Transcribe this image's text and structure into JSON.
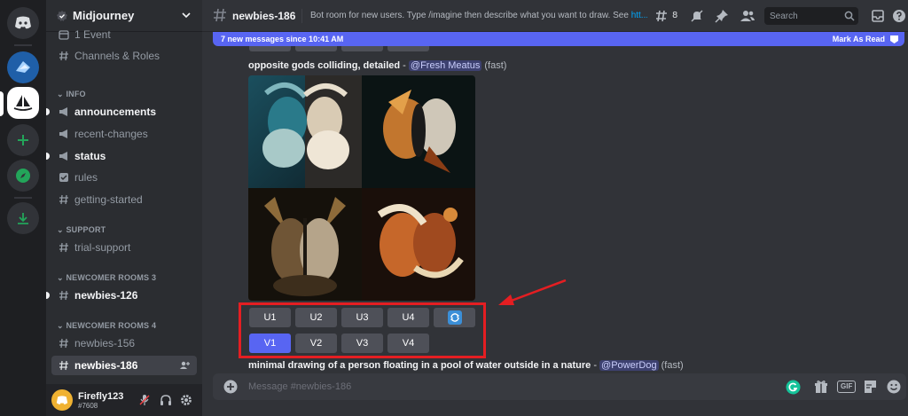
{
  "server": {
    "name": "Midjourney"
  },
  "sidebar": {
    "top_items": [
      {
        "label": "1 Event"
      },
      {
        "label": "Channels & Roles"
      }
    ],
    "categories": [
      {
        "label": "INFO"
      },
      {
        "label": "SUPPORT"
      },
      {
        "label": "NEWCOMER ROOMS 3"
      },
      {
        "label": "NEWCOMER ROOMS 4"
      }
    ],
    "channels": [
      {
        "label": "announcements",
        "icon": "megaphone-icon",
        "state": "unread"
      },
      {
        "label": "recent-changes",
        "icon": "megaphone-icon",
        "state": "normal"
      },
      {
        "label": "status",
        "icon": "megaphone-icon",
        "state": "unread"
      },
      {
        "label": "rules",
        "icon": "checkbox-icon",
        "state": "normal"
      },
      {
        "label": "getting-started",
        "icon": "hash-icon",
        "state": "normal"
      },
      {
        "label": "trial-support",
        "icon": "hash-icon",
        "state": "normal"
      },
      {
        "label": "newbies-126",
        "icon": "hash-icon",
        "state": "unread"
      },
      {
        "label": "newbies-156",
        "icon": "hash-icon",
        "state": "normal"
      },
      {
        "label": "newbies-186",
        "icon": "hash-icon",
        "state": "active"
      }
    ]
  },
  "user": {
    "name": "Firefly123",
    "tag": "#7608"
  },
  "channel_header": {
    "name": "newbies-186",
    "topic": "Bot room for new users. Type /imagine then describe what you want to draw. See ",
    "topic_link": "htt...",
    "thread_count": "8",
    "search_placeholder": "Search"
  },
  "new_messages_bar": {
    "text": "7 new messages since 10:41 AM",
    "action": "Mark As Read"
  },
  "messages": [
    {
      "prompt": "opposite gods colliding, detailed",
      "separator": " - ",
      "mention": "@Fresh Meatus",
      "speed": " (fast)"
    },
    {
      "prompt": "minimal drawing of a person floating in a pool of water outside in a nature",
      "separator": " - ",
      "mention": "@PowerDog",
      "speed": " (fast)"
    }
  ],
  "buttons": {
    "upscale": [
      "U1",
      "U2",
      "U3",
      "U4"
    ],
    "variation": [
      "V1",
      "V2",
      "V3",
      "V4"
    ],
    "selected": "V1"
  },
  "composer": {
    "placeholder": "Message #newbies-186"
  },
  "colors": {
    "accent": "#5865f2",
    "highlight_box": "#e41e22",
    "arrow": "#e41e22"
  }
}
